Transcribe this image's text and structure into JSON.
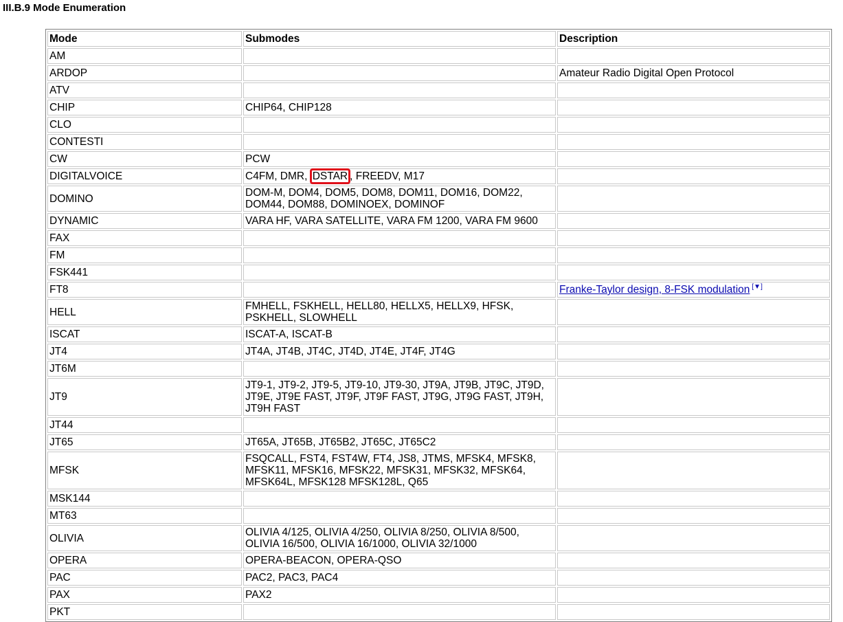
{
  "heading": "III.B.9 Mode Enumeration",
  "table": {
    "headers": [
      "Mode",
      "Submodes",
      "Description"
    ],
    "rows": [
      {
        "mode": "AM",
        "submodes": "",
        "description": ""
      },
      {
        "mode": "ARDOP",
        "submodes": "",
        "description": "Amateur Radio Digital Open Protocol"
      },
      {
        "mode": "ATV",
        "submodes": "",
        "description": ""
      },
      {
        "mode": "CHIP",
        "submodes": "CHIP64, CHIP128",
        "description": ""
      },
      {
        "mode": "CLO",
        "submodes": "",
        "description": ""
      },
      {
        "mode": "CONTESTI",
        "submodes": "",
        "description": ""
      },
      {
        "mode": "CW",
        "submodes": "PCW",
        "description": ""
      },
      {
        "mode": "DIGITALVOICE",
        "submodes_before": "C4FM, DMR, ",
        "submodes_highlight": "DSTAR",
        "submodes_after": ", FREEDV, M17",
        "description": ""
      },
      {
        "mode": "DOMINO",
        "submodes": "DOM-M, DOM4, DOM5, DOM8, DOM11, DOM16, DOM22, DOM44, DOM88, DOMINOEX, DOMINOF",
        "description": ""
      },
      {
        "mode": "DYNAMIC",
        "submodes": "VARA HF, VARA SATELLITE, VARA FM 1200, VARA FM 9600",
        "description": ""
      },
      {
        "mode": "FAX",
        "submodes": "",
        "description": ""
      },
      {
        "mode": "FM",
        "submodes": "",
        "description": ""
      },
      {
        "mode": "FSK441",
        "submodes": "",
        "description": ""
      },
      {
        "mode": "FT8",
        "submodes": "",
        "description_link": "Franke-Taylor design, 8-FSK modulation",
        "description_note": "[▼]"
      },
      {
        "mode": "HELL",
        "submodes": "FMHELL, FSKHELL, HELL80, HELLX5, HELLX9, HFSK, PSKHELL, SLOWHELL",
        "description": ""
      },
      {
        "mode": "ISCAT",
        "submodes": "ISCAT-A, ISCAT-B",
        "description": ""
      },
      {
        "mode": "JT4",
        "submodes": "JT4A, JT4B, JT4C, JT4D, JT4E, JT4F, JT4G",
        "description": ""
      },
      {
        "mode": "JT6M",
        "submodes": "",
        "description": ""
      },
      {
        "mode": "JT9",
        "submodes": "JT9-1, JT9-2, JT9-5, JT9-10, JT9-30, JT9A, JT9B, JT9C, JT9D, JT9E, JT9E FAST, JT9F, JT9F FAST, JT9G, JT9G FAST, JT9H, JT9H FAST",
        "description": ""
      },
      {
        "mode": "JT44",
        "submodes": "",
        "description": ""
      },
      {
        "mode": "JT65",
        "submodes": "JT65A, JT65B, JT65B2, JT65C, JT65C2",
        "description": ""
      },
      {
        "mode": "MFSK",
        "submodes": "FSQCALL, FST4, FST4W, FT4, JS8, JTMS, MFSK4, MFSK8, MFSK11, MFSK16, MFSK22, MFSK31, MFSK32, MFSK64, MFSK64L, MFSK128 MFSK128L, Q65",
        "description": ""
      },
      {
        "mode": "MSK144",
        "submodes": "",
        "description": ""
      },
      {
        "mode": "MT63",
        "submodes": "",
        "description": ""
      },
      {
        "mode": "OLIVIA",
        "submodes": "OLIVIA 4/125, OLIVIA 4/250, OLIVIA 8/250, OLIVIA 8/500, OLIVIA 16/500, OLIVIA 16/1000, OLIVIA 32/1000",
        "description": ""
      },
      {
        "mode": "OPERA",
        "submodes": "OPERA-BEACON, OPERA-QSO",
        "description": ""
      },
      {
        "mode": "PAC",
        "submodes": "PAC2, PAC3, PAC4",
        "description": ""
      },
      {
        "mode": "PAX",
        "submodes": "PAX2",
        "description": ""
      },
      {
        "mode": "PKT",
        "submodes": "",
        "description": ""
      }
    ]
  },
  "colors": {
    "highlight": "#e0101a",
    "link": "#0a0ab0",
    "cell_border": "#c8c8c8",
    "table_border": "#808080"
  }
}
